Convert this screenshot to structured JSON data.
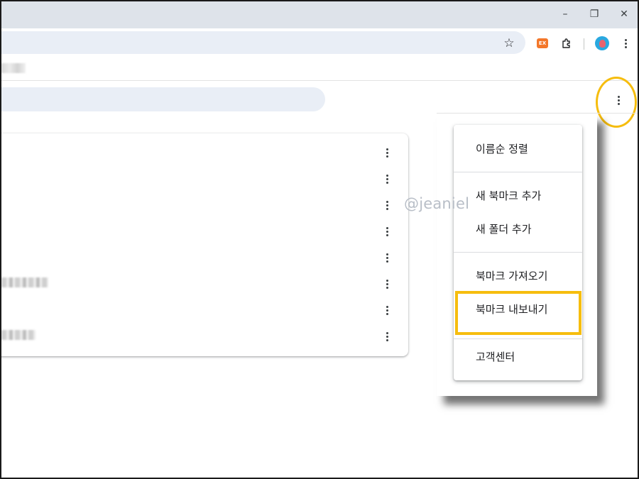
{
  "window": {
    "minimize_label": "–",
    "maximize_label": "❐",
    "close_label": "✕"
  },
  "toolbar": {
    "star_icon": "star-icon",
    "extension_badge": "EX",
    "puzzle_icon": "extensions-puzzle-icon",
    "profile_icon": "profile-avatar",
    "menu_icon": "more-vert-icon"
  },
  "bookmark_rows": [
    {
      "has_text": false
    },
    {
      "has_text": false
    },
    {
      "has_text": false
    },
    {
      "has_text": false
    },
    {
      "has_text": false
    },
    {
      "has_text": true
    },
    {
      "has_text": false
    },
    {
      "has_text": true
    }
  ],
  "dropdown": {
    "sort_by_name": "이름순 정렬",
    "add_bookmark": "새 북마크 추가",
    "add_folder": "새 폴더 추가",
    "import_bookmarks": "북마크 가져오기",
    "export_bookmarks": "북마크 내보내기",
    "help_center": "고객센터"
  },
  "watermark": "@jeaniel",
  "colors": {
    "highlight": "#f6bd0e",
    "titlebar": "#dee3ea",
    "omnibox": "#e9eef6",
    "extension_orange": "#f3772a"
  }
}
